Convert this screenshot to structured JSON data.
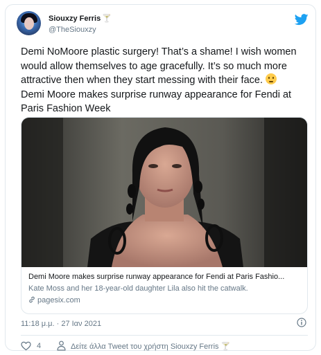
{
  "author": {
    "name": "Siouxzy Ferris",
    "name_emoji": "🍸",
    "handle": "@TheSiouxzy"
  },
  "tweet": {
    "text": "Demi NoMoore plastic surgery! That’s a shame! I wish women would allow themselves to age gracefully. It’s so much more attractive then when they start messing with their face. ",
    "text_emoji": "slightly-frowning-face",
    "text_line2": "Demi Moore makes surprise runway appearance for Fendi at Paris Fashion Week"
  },
  "link_card": {
    "title": "Demi Moore makes surprise runway appearance for Fendi at Paris Fashio...",
    "description": "Kate Moss and her 18-year-old daughter Lila also hit the catwalk.",
    "domain": "pagesix.com"
  },
  "meta": {
    "timestamp": "11:18 μ.μ. · 27 Ιαν 2021"
  },
  "actions": {
    "like_count": "4",
    "more_tweets_label": "Δείτε άλλα Tweet του χρήστη Siouxzy Ferris",
    "more_tweets_emoji": "🍸"
  },
  "icons": {
    "logo": "twitter-bird-icon",
    "info": "info-icon",
    "like": "heart-icon",
    "profile": "person-icon",
    "link": "link-icon"
  },
  "colors": {
    "brand": "#1da1f2",
    "text": "#14171a",
    "secondary": "#657786",
    "border": "#e1e8ed"
  }
}
